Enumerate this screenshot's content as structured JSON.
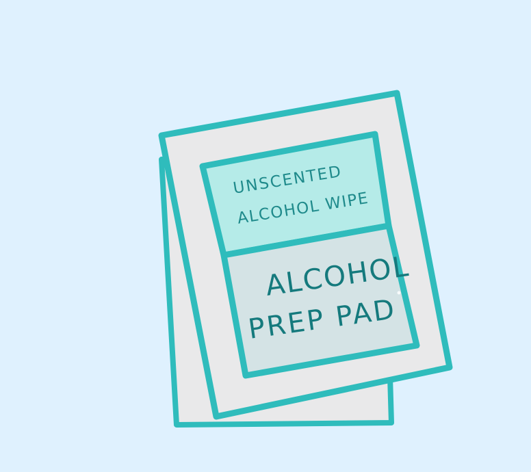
{
  "illustration": {
    "top_label_line1": "UNSCENTED",
    "top_label_line2": "ALCOHOL WIPE",
    "main_label_line1": "ALCOHOL",
    "main_label_line2": "PREP PAD"
  },
  "colors": {
    "background": "#dff1fe",
    "outline": "#2fbcbc",
    "packet_fill": "#e9e9ea",
    "top_panel_fill": "#b5ebe8",
    "bottom_panel_fill": "#d4e3e5",
    "small_text": "#1f8a8b",
    "large_text": "#157a7d"
  }
}
